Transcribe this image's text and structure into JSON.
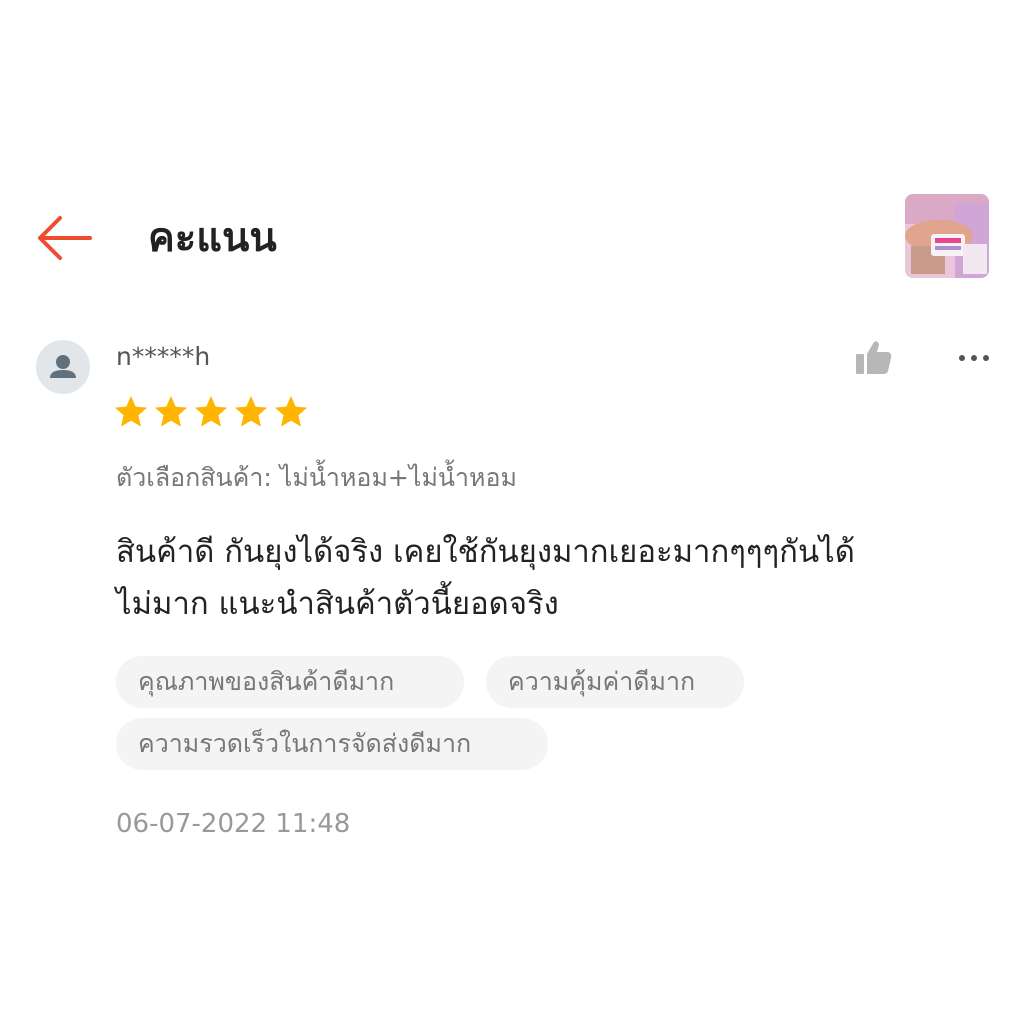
{
  "header": {
    "title": "คะแนน"
  },
  "review": {
    "username": "n*****h",
    "rating": 5,
    "max_rating": 5,
    "variant_text": "ตัวเลือกสินค้า: ไม่น้ำหอม+ไม่น้ำหอม",
    "comment_line1": "สินค้าดี กันยุงได้จริง เคยใช้กันยุงมากเยอะมากๆๆๆกันได้",
    "comment_line2": "ไม่มาก แนะนำสินค้าตัวนี้ยอดจริง",
    "tags": [
      "คุณภาพของสินค้าดีมาก",
      "ความคุ้มค่าดีมาก",
      "ความรวดเร็วในการจัดส่งดีมาก"
    ],
    "timestamp": "06-07-2022 11:48"
  },
  "colors": {
    "accent": "#ee4d2d",
    "star": "#ffb400",
    "icon_gray": "#b7b7b7"
  },
  "icons": {
    "back": "arrow-left-icon",
    "like": "thumbs-up-icon",
    "more": "more-horizontal-icon",
    "avatar": "user-icon",
    "star": "star-icon"
  }
}
